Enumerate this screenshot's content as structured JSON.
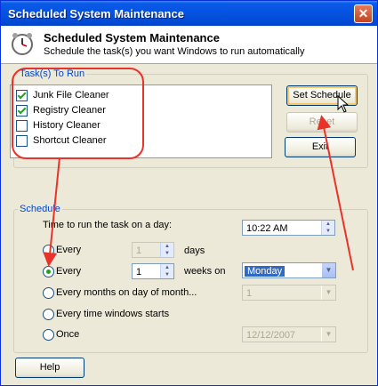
{
  "window": {
    "title": "Scheduled System Maintenance",
    "close": "✕"
  },
  "header": {
    "title": "Scheduled System Maintenance",
    "subtitle": "Schedule the task(s) you want Windows to run automatically"
  },
  "tasks": {
    "legend": "Task(s) To Run",
    "items": [
      {
        "label": "Junk File Cleaner",
        "checked": true
      },
      {
        "label": "Registry Cleaner",
        "checked": true
      },
      {
        "label": "History Cleaner",
        "checked": false
      },
      {
        "label": "Shortcut Cleaner",
        "checked": false
      }
    ]
  },
  "buttons": {
    "set_schedule": "Set Schedule",
    "reset": "Reset",
    "exit": "Exit",
    "help": "Help"
  },
  "schedule": {
    "legend": "Schedule",
    "time_label": "Time to run the task on a day:",
    "time_value": "10:22 AM",
    "every_days": {
      "label": "Every",
      "value": "1",
      "unit": "days",
      "selected": false
    },
    "every_weeks": {
      "label": "Every",
      "value": "1",
      "unit": "weeks on",
      "day": "Monday",
      "selected": true
    },
    "every_months": {
      "label": "Every months on day of month...",
      "value": "1",
      "selected": false
    },
    "every_start": {
      "label": "Every time windows starts",
      "selected": false
    },
    "once": {
      "label": "Once",
      "date": "12/12/2007",
      "selected": false
    }
  },
  "colors": {
    "annotation": "#e8332b",
    "title_bar": "#0a5ae8",
    "legend": "#0046d5"
  }
}
